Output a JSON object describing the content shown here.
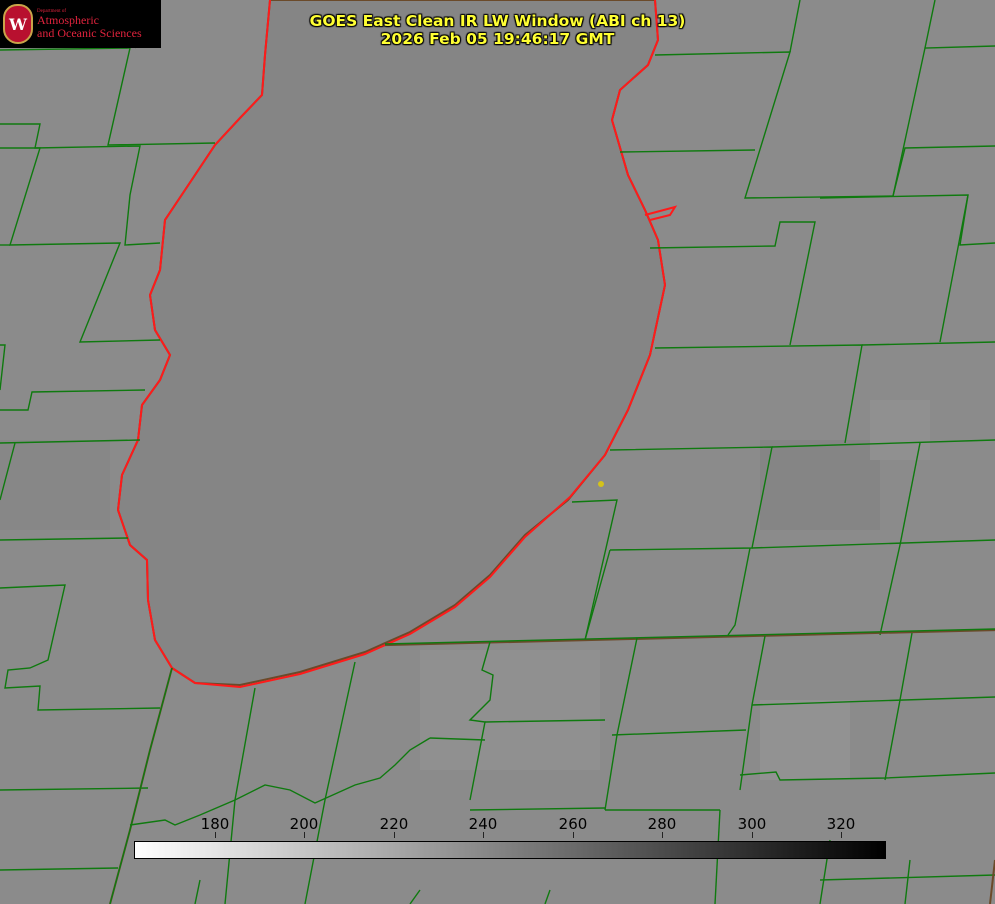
{
  "header": {
    "title_line1": "GOES East Clean IR LW Window (ABI ch 13)",
    "title_line2": "2026 Feb 05 19:46:17 GMT"
  },
  "logo": {
    "department": "Department of",
    "line1": "Atmospheric",
    "line2": "and Oceanic Sciences",
    "seal_letter": "W"
  },
  "colorbar": {
    "labels": [
      "180",
      "200",
      "220",
      "240",
      "260",
      "280",
      "300",
      "320"
    ],
    "min_value": 162,
    "max_value": 330,
    "color_low": "#ffffff",
    "color_high": "#000000"
  },
  "colors": {
    "background": "#8a8a8a",
    "lake": "#858585",
    "boundary_green": "#0f7a0f",
    "shoreline_red": "#ff1a1a",
    "marker_yellow": "#d4c21a",
    "title_yellow": "#ffff33"
  }
}
